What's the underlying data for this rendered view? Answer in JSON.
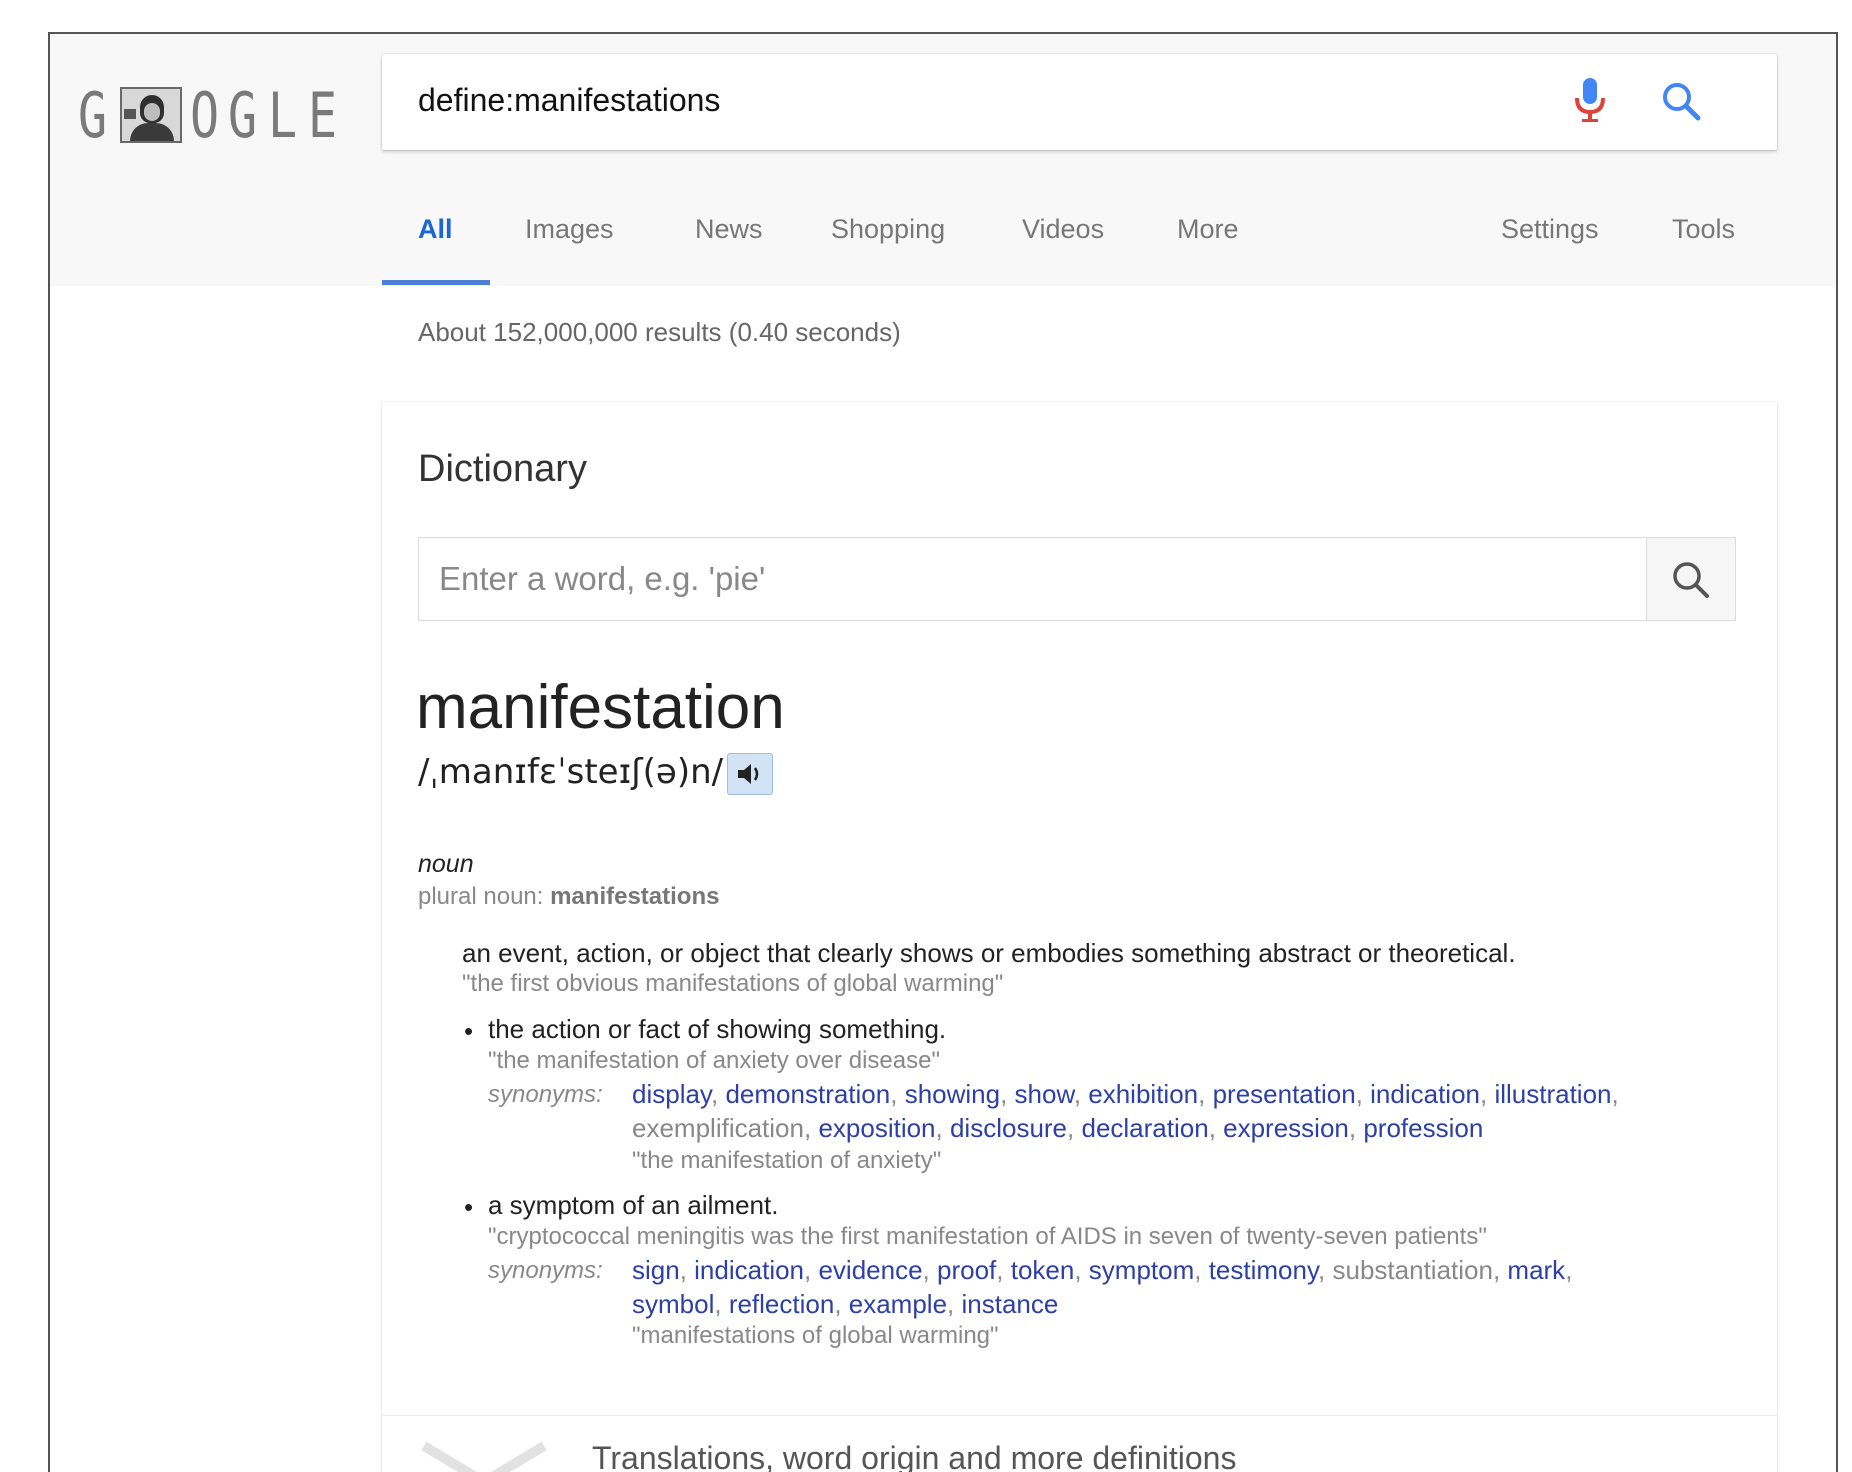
{
  "logo": {
    "letters_left": "G",
    "letters_right": [
      "G",
      "L",
      "E"
    ],
    "extra": "O"
  },
  "search": {
    "query": "define:manifestations"
  },
  "tabs": [
    {
      "label": "All"
    },
    {
      "label": "Images"
    },
    {
      "label": "News"
    },
    {
      "label": "Shopping"
    },
    {
      "label": "Videos"
    },
    {
      "label": "More"
    },
    {
      "label": "Settings"
    },
    {
      "label": "Tools"
    }
  ],
  "results_stats": "About 152,000,000 results (0.40 seconds)",
  "dictionary": {
    "title": "Dictionary",
    "input_placeholder": "Enter a word, e.g. 'pie'",
    "word": "manifestation",
    "phonetic": "/ˌmanɪfɛˈsteɪʃ(ə)n/",
    "part_of_speech": "noun",
    "plural_label": "plural noun: ",
    "plural_value": "manifestations",
    "main_definition": "an event, action, or object that clearly shows or embodies something abstract or theoretical.",
    "main_example": "\"the first obvious manifestations of global warming\"",
    "senses": [
      {
        "bullet": "•",
        "definition": "the action or fact of showing something.",
        "example": "\"the manifestation of anxiety over disease\"",
        "synonyms_label": "synonyms:",
        "synonyms_line1": [
          {
            "w": "display",
            "link": true
          },
          {
            "w": ", ",
            "link": false
          },
          {
            "w": "demonstration",
            "link": true
          },
          {
            "w": ", ",
            "link": false
          },
          {
            "w": "showing",
            "link": true
          },
          {
            "w": ", ",
            "link": false
          },
          {
            "w": "show",
            "link": true
          },
          {
            "w": ", ",
            "link": false
          },
          {
            "w": "exhibition",
            "link": true
          },
          {
            "w": ", ",
            "link": false
          },
          {
            "w": "presentation",
            "link": true
          },
          {
            "w": ", ",
            "link": false
          },
          {
            "w": "indication",
            "link": true
          },
          {
            "w": ", ",
            "link": false
          },
          {
            "w": "illustration",
            "link": true
          },
          {
            "w": ",",
            "link": false
          }
        ],
        "synonyms_line2": [
          {
            "w": "exemplification",
            "link": false
          },
          {
            "w": ", ",
            "link": false
          },
          {
            "w": "exposition",
            "link": true
          },
          {
            "w": ", ",
            "link": false
          },
          {
            "w": "disclosure",
            "link": true
          },
          {
            "w": ", ",
            "link": false
          },
          {
            "w": "declaration",
            "link": true
          },
          {
            "w": ", ",
            "link": false
          },
          {
            "w": "expression",
            "link": true
          },
          {
            "w": ", ",
            "link": false
          },
          {
            "w": "profession",
            "link": true
          }
        ],
        "synonyms_example": "\"the manifestation of anxiety\""
      },
      {
        "bullet": "•",
        "definition": "a symptom of an ailment.",
        "example": "\"cryptococcal meningitis was the first manifestation of AIDS in seven of twenty-seven patients\"",
        "synonyms_label": "synonyms:",
        "synonyms_line1": [
          {
            "w": "sign",
            "link": true
          },
          {
            "w": ", ",
            "link": false
          },
          {
            "w": "indication",
            "link": true
          },
          {
            "w": ", ",
            "link": false
          },
          {
            "w": "evidence",
            "link": true
          },
          {
            "w": ", ",
            "link": false
          },
          {
            "w": "proof",
            "link": true
          },
          {
            "w": ", ",
            "link": false
          },
          {
            "w": "token",
            "link": true
          },
          {
            "w": ", ",
            "link": false
          },
          {
            "w": "symptom",
            "link": true
          },
          {
            "w": ", ",
            "link": false
          },
          {
            "w": "testimony",
            "link": true
          },
          {
            "w": ", ",
            "link": false
          },
          {
            "w": "substantiation",
            "link": false
          },
          {
            "w": ", ",
            "link": false
          },
          {
            "w": "mark",
            "link": true
          },
          {
            "w": ",",
            "link": false
          }
        ],
        "synonyms_line2": [
          {
            "w": "symbol",
            "link": true
          },
          {
            "w": ", ",
            "link": false
          },
          {
            "w": "reflection",
            "link": true
          },
          {
            "w": ", ",
            "link": false
          },
          {
            "w": "example",
            "link": true
          },
          {
            "w": ", ",
            "link": false
          },
          {
            "w": "instance",
            "link": true
          }
        ],
        "synonyms_example": "\"manifestations of global warming\""
      }
    ],
    "footer_label": "Translations, word origin and more definitions"
  },
  "colors": {
    "accent_blue": "#1a66d2",
    "synonym_link": "#2d3fa8",
    "mic_red": "#db4437",
    "mic_blue": "#4285f4"
  }
}
